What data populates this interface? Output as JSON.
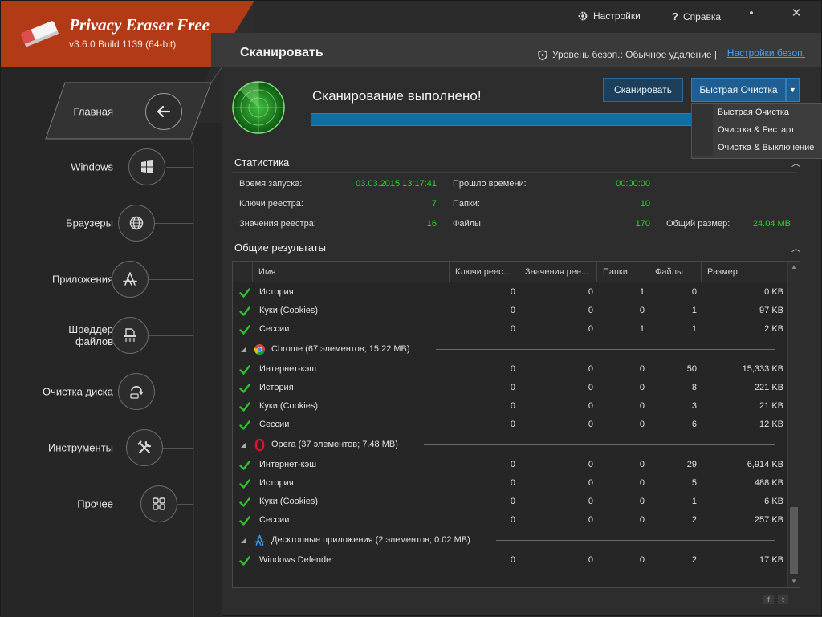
{
  "brand": {
    "app_name": "Privacy Eraser Free",
    "version": "v3.6.0 Build 1139 (64-bit)",
    "color": "#b23a17"
  },
  "topbar": {
    "settings_label": "Настройки",
    "help_label": "Справка",
    "minimize_glyph": "•",
    "close_glyph": "✕"
  },
  "subbar": {
    "title": "Сканировать",
    "security_level": "Уровень безоп.: Обычное удаление |",
    "security_settings_link": "Настройки безоп."
  },
  "sidebar": {
    "items": [
      {
        "label": "Главная",
        "icon": "arrow-left-icon",
        "active": true
      },
      {
        "label": "Windows",
        "icon": "windows-icon"
      },
      {
        "label": "Браузеры",
        "icon": "globe-icon"
      },
      {
        "label": "Приложения",
        "icon": "apps-icon"
      },
      {
        "label": "Шреддер\nфайлов",
        "label_line1": "Шреддер",
        "label_line2": "файлов",
        "icon": "shredder-icon"
      },
      {
        "label": "Очистка диска",
        "icon": "disk-clean-icon"
      },
      {
        "label": "Инструменты",
        "icon": "tools-icon"
      },
      {
        "label": "Прочее",
        "icon": "more-icon"
      }
    ]
  },
  "scan": {
    "status": "Сканирование выполнено!",
    "progress": 1.0,
    "scan_button": "Сканировать",
    "quick_clean_button": "Быстрая Очистка",
    "dropdown_arrow": "▼",
    "dropdown_items": [
      "Быстрая Очистка",
      "Очистка & Рестарт",
      "Очистка & Выключение"
    ]
  },
  "stats": {
    "title": "Статистика",
    "start_time_label": "Время запуска:",
    "start_time": "03.03.2015 13:17:41",
    "elapsed_label": "Прошло времени:",
    "elapsed": "00:00:00",
    "reg_keys_label": "Ключи реестра:",
    "reg_keys": "7",
    "folders_label": "Папки:",
    "folders": "10",
    "reg_values_label": "Значения реестра:",
    "reg_values": "16",
    "files_label": "Файлы:",
    "files": "170",
    "total_size_label": "Общий размер:",
    "total_size": "24.04 MB"
  },
  "results": {
    "title": "Общие результаты",
    "columns": [
      "Имя",
      "Ключи реес...",
      "Значения рее...",
      "Папки",
      "Файлы",
      "Размер"
    ],
    "rows": [
      {
        "type": "item",
        "name": "История",
        "keys": "0",
        "values": "0",
        "folders": "1",
        "files": "0",
        "size": "0 KB"
      },
      {
        "type": "item",
        "name": "Куки (Cookies)",
        "keys": "0",
        "values": "0",
        "folders": "0",
        "files": "1",
        "size": "97 KB"
      },
      {
        "type": "item",
        "name": "Сессии",
        "keys": "0",
        "values": "0",
        "folders": "1",
        "files": "1",
        "size": "2 KB"
      },
      {
        "type": "group",
        "name": "Chrome (67 элементов; 15.22 MB)",
        "icon": "chrome-icon"
      },
      {
        "type": "item",
        "name": "Интернет-кэш",
        "keys": "0",
        "values": "0",
        "folders": "0",
        "files": "50",
        "size": "15,333 KB"
      },
      {
        "type": "item",
        "name": "История",
        "keys": "0",
        "values": "0",
        "folders": "0",
        "files": "8",
        "size": "221 KB"
      },
      {
        "type": "item",
        "name": "Куки (Cookies)",
        "keys": "0",
        "values": "0",
        "folders": "0",
        "files": "3",
        "size": "21 KB"
      },
      {
        "type": "item",
        "name": "Сессии",
        "keys": "0",
        "values": "0",
        "folders": "0",
        "files": "6",
        "size": "12 KB"
      },
      {
        "type": "group",
        "name": "Opera (37 элементов; 7.48 MB)",
        "icon": "opera-icon"
      },
      {
        "type": "item",
        "name": "Интернет-кэш",
        "keys": "0",
        "values": "0",
        "folders": "0",
        "files": "29",
        "size": "6,914 KB"
      },
      {
        "type": "item",
        "name": "История",
        "keys": "0",
        "values": "0",
        "folders": "0",
        "files": "5",
        "size": "488 KB"
      },
      {
        "type": "item",
        "name": "Куки (Cookies)",
        "keys": "0",
        "values": "0",
        "folders": "0",
        "files": "1",
        "size": "6 KB"
      },
      {
        "type": "item",
        "name": "Сессии",
        "keys": "0",
        "values": "0",
        "folders": "0",
        "files": "2",
        "size": "257 KB"
      },
      {
        "type": "group",
        "name": "Десктопные приложения (2 элементов; 0.02 MB)",
        "icon": "apps-icon"
      },
      {
        "type": "item",
        "name": "Windows Defender",
        "keys": "0",
        "values": "0",
        "folders": "0",
        "files": "2",
        "size": "17 KB"
      }
    ]
  },
  "social": {
    "facebook": "f",
    "twitter": "t"
  },
  "colors": {
    "accent_blue": "#1f5e92",
    "value_green": "#29d629",
    "link_blue": "#3ea4ff"
  }
}
